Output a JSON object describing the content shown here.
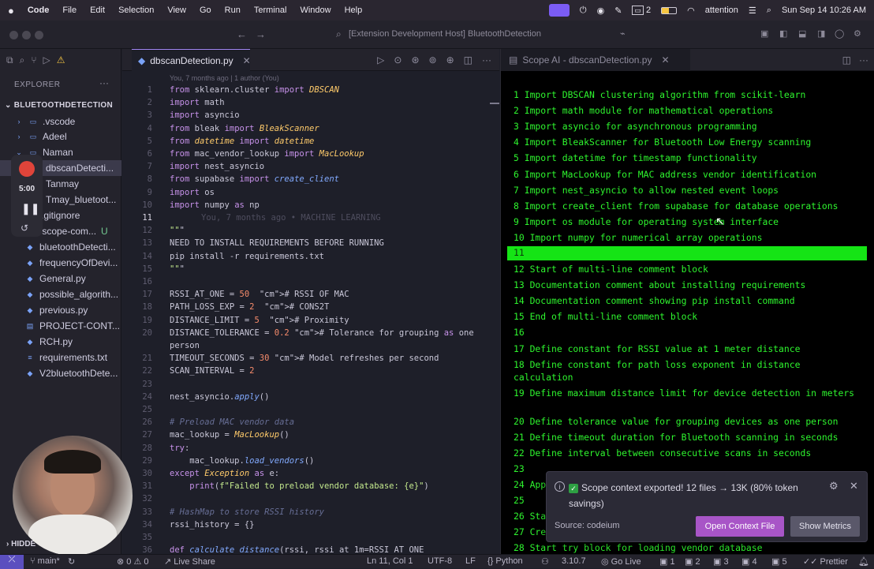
{
  "menubar": {
    "app": "Code",
    "items": [
      "File",
      "Edit",
      "Selection",
      "View",
      "Go",
      "Run",
      "Terminal",
      "Window",
      "Help"
    ],
    "status_badge": "2",
    "user": "attention",
    "clock": "Sun Sep 14  10:26 AM"
  },
  "window": {
    "title": "[Extension Development Host] BluetoothDetection"
  },
  "sidebar": {
    "title": "EXPLORER",
    "project": "BLUETOOTHDETECTION",
    "items": [
      {
        "label": ".vscode",
        "kind": "folder"
      },
      {
        "label": "Adeel",
        "kind": "folder"
      },
      {
        "label": "Naman",
        "kind": "folder"
      },
      {
        "label": "dbscanDetecti...",
        "kind": "file"
      },
      {
        "label": "Tanmay",
        "kind": "folder"
      },
      {
        "label": "Tmay_bluetoot...",
        "kind": "file"
      },
      {
        "label": ".gitignore",
        "kind": "file"
      },
      {
        "label": ".scope-com...",
        "kind": "file",
        "badge": "U"
      },
      {
        "label": "bluetoothDetecti...",
        "kind": "file"
      },
      {
        "label": "frequencyOfDevi...",
        "kind": "file"
      },
      {
        "label": "General.py",
        "kind": "file"
      },
      {
        "label": "possible_algorith...",
        "kind": "file"
      },
      {
        "label": "previous.py",
        "kind": "file"
      },
      {
        "label": "PROJECT-CONT...",
        "kind": "file"
      },
      {
        "label": "RCH.py",
        "kind": "file"
      },
      {
        "label": "requirements.txt",
        "kind": "file"
      },
      {
        "label": "V2bluetoothDete...",
        "kind": "file"
      }
    ],
    "hidden_label": "HIDDE",
    "recording_time": "5:00"
  },
  "editor": {
    "tab": "dbscanDetection.py",
    "blame": "You, 7 months ago | 1 author (You)",
    "inline_blame": "You, 7 months ago • MACHINE LEARNING",
    "lines": [
      {
        "n": "1",
        "t": "from sklearn.cluster import DBSCAN"
      },
      {
        "n": "2",
        "t": "import math"
      },
      {
        "n": "3",
        "t": "import asyncio"
      },
      {
        "n": "4",
        "t": "from bleak import BleakScanner"
      },
      {
        "n": "5",
        "t": "from datetime import datetime"
      },
      {
        "n": "6",
        "t": "from mac_vendor_lookup import MacLookup"
      },
      {
        "n": "7",
        "t": "import nest_asyncio"
      },
      {
        "n": "8",
        "t": "from supabase import create_client"
      },
      {
        "n": "9",
        "t": "import os"
      },
      {
        "n": "10",
        "t": "import numpy as np"
      },
      {
        "n": "11",
        "t": ""
      },
      {
        "n": "12",
        "t": "\"\"\""
      },
      {
        "n": "13",
        "t": "NEED TO INSTALL REQUIREMENTS BEFORE RUNNING"
      },
      {
        "n": "14",
        "t": "pip install -r requirements.txt"
      },
      {
        "n": "15",
        "t": "\"\"\""
      },
      {
        "n": "16",
        "t": ""
      },
      {
        "n": "17",
        "t": "RSSI_AT_ONE = 50  # RSSI OF MAC"
      },
      {
        "n": "18",
        "t": "PATH_LOSS_EXP = 2  # CONS2T"
      },
      {
        "n": "19",
        "t": "DISTANCE_LIMIT = 5  # Proximity"
      },
      {
        "n": "20",
        "t": "DISTANCE_TOLERANCE = 0.2 # Tolerance for grouping as one"
      },
      {
        "n": "",
        "t": "person"
      },
      {
        "n": "21",
        "t": "TIMEOUT_SECONDS = 30 # Model refreshes per second"
      },
      {
        "n": "22",
        "t": "SCAN_INTERVAL = 2"
      },
      {
        "n": "23",
        "t": ""
      },
      {
        "n": "24",
        "t": "nest_asyncio.apply()"
      },
      {
        "n": "25",
        "t": ""
      },
      {
        "n": "26",
        "t": "# Preload MAC vendor data"
      },
      {
        "n": "27",
        "t": "mac_lookup = MacLookup()"
      },
      {
        "n": "28",
        "t": "try:"
      },
      {
        "n": "29",
        "t": "    mac_lookup.load_vendors()"
      },
      {
        "n": "30",
        "t": "except Exception as e:"
      },
      {
        "n": "31",
        "t": "    print(f\"Failed to preload vendor database: {e}\")"
      },
      {
        "n": "32",
        "t": ""
      },
      {
        "n": "33",
        "t": "# HashMap to store RSSI history"
      },
      {
        "n": "34",
        "t": "rssi_history = {}"
      },
      {
        "n": "35",
        "t": ""
      },
      {
        "n": "36",
        "t": "def calculate_distance(rssi, rssi_at_1m=RSSI_AT_ONE"
      }
    ]
  },
  "scope_panel": {
    "tab": "Scope AI - dbscanDetection.py",
    "lines": [
      "1 Import DBSCAN clustering algorithm from scikit-learn",
      "2 Import math module for mathematical operations",
      "3 Import asyncio for asynchronous programming",
      "4 Import BleakScanner for Bluetooth Low Energy scanning",
      "5 Import datetime for timestamp functionality",
      "6 Import MacLookup for MAC address vendor identification",
      "7 Import nest_asyncio to allow nested event loops",
      "8 Import create_client from supabase for database operations",
      "9 Import os module for operating system interface",
      "10 Import numpy for numerical array operations",
      "11",
      "12 Start of multi-line comment block",
      "13 Documentation comment about installing requirements",
      "14 Documentation comment showing pip install command",
      "15 End of multi-line comment block",
      "16",
      "17 Define constant for RSSI value at 1 meter distance",
      "18 Define constant for path loss exponent in distance calculation",
      "19 Define maximum distance limit for device detection in meters",
      "20 Define tolerance value for grouping devices as one person",
      "21 Define timeout duration for Bluetooth scanning in seconds",
      "22 Define interval between consecutive scans in seconds",
      "23",
      "24 App",
      "25",
      "26 Sta",
      "27 Cre",
      "28 Start try block for loading vendor database"
    ]
  },
  "notification": {
    "message": "Scope context exported! 12 files → 13K (80% token savings)",
    "source": "Source: codeium",
    "primary_button": "Open Context File",
    "secondary_button": "Show Metrics"
  },
  "statusbar": {
    "branch": "main*",
    "errors": "0",
    "warnings": "0",
    "live_share": "Live Share",
    "position": "Ln 11, Col 1",
    "encoding": "UTF-8",
    "eol": "LF",
    "language": "Python",
    "version": "3.10.7",
    "go_live": "Go Live",
    "counters": [
      "1",
      "2",
      "3",
      "4",
      "5"
    ],
    "prettier": "Prettier"
  }
}
